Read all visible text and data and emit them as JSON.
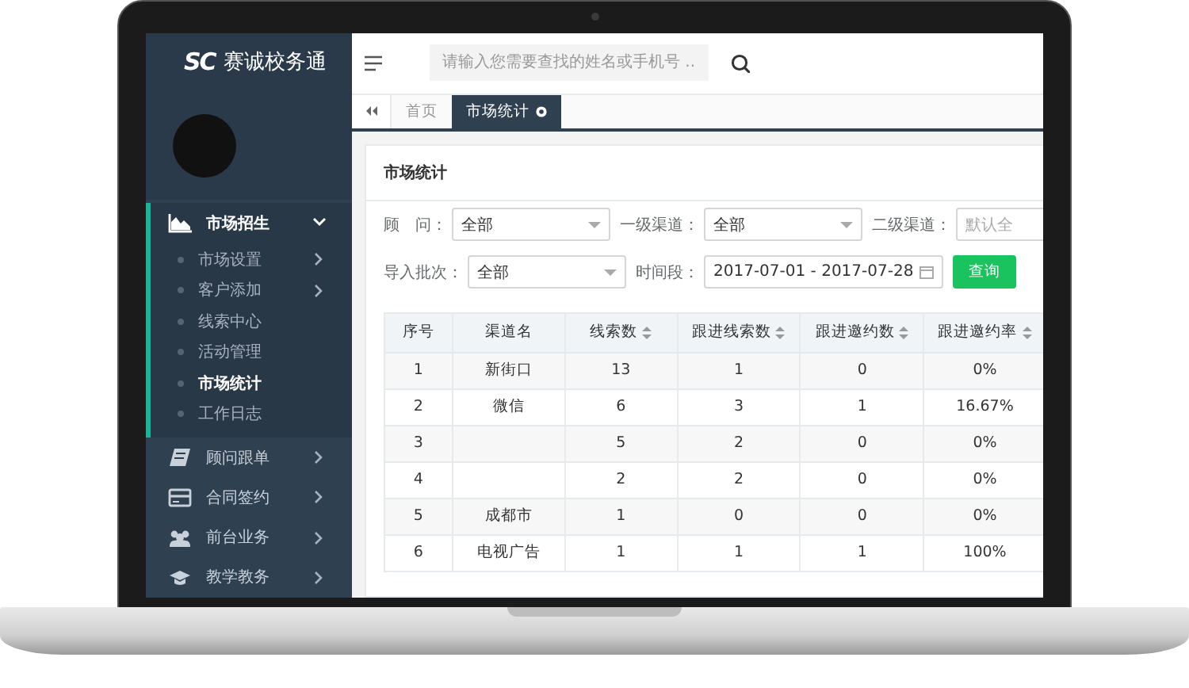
{
  "app": {
    "logo_text": "赛诚校务通",
    "logo_mark": "SC"
  },
  "header": {
    "search_placeholder": "请输入您需要查找的姓名或手机号 ..."
  },
  "tabs": [
    {
      "label": "首页",
      "selected": false,
      "closable": false
    },
    {
      "label": "市场统计",
      "selected": true,
      "closable": true
    }
  ],
  "sidebar": {
    "items": [
      {
        "label": "市场招生",
        "kind": "chart",
        "expanded": true,
        "children": [
          {
            "label": "市场设置",
            "has_children": true,
            "selected": false
          },
          {
            "label": "客户添加",
            "has_children": true,
            "selected": false
          },
          {
            "label": "线索中心",
            "has_children": false,
            "selected": false
          },
          {
            "label": "活动管理",
            "has_children": false,
            "selected": false
          },
          {
            "label": "市场统计",
            "has_children": false,
            "selected": true
          },
          {
            "label": "工作日志",
            "has_children": false,
            "selected": false
          }
        ]
      },
      {
        "label": "顾问跟单",
        "kind": "book",
        "expanded": false
      },
      {
        "label": "合同签约",
        "kind": "card",
        "expanded": false
      },
      {
        "label": "前台业务",
        "kind": "people",
        "expanded": false
      },
      {
        "label": "教学教务",
        "kind": "cap",
        "expanded": false
      }
    ]
  },
  "page": {
    "title": "市场统计",
    "filter_rows": [
      [
        {
          "label": "顾　问：",
          "kind": "select",
          "value": "全部"
        },
        {
          "label": "一级渠道：",
          "kind": "select",
          "value": "全部"
        },
        {
          "label": "二级渠道：",
          "kind": "text",
          "placeholder": "默认全"
        }
      ],
      [
        {
          "label": "导入批次：",
          "kind": "select",
          "value": "全部"
        },
        {
          "label": "时间段：",
          "kind": "daterange",
          "value": "2017-07-01 - 2017-07-28"
        }
      ]
    ],
    "query_button": "查询"
  },
  "table": {
    "columns": [
      {
        "label": "序号",
        "sortable": false
      },
      {
        "label": "渠道名",
        "sortable": false
      },
      {
        "label": "线索数",
        "sortable": true
      },
      {
        "label": "跟进线索数",
        "sortable": true
      },
      {
        "label": "跟进邀约数",
        "sortable": true
      },
      {
        "label": "跟进邀约率",
        "sortable": true
      }
    ],
    "rows": [
      [
        "1",
        "新街口",
        "13",
        "1",
        "0",
        "0%"
      ],
      [
        "2",
        "微信",
        "6",
        "3",
        "1",
        "16.67%"
      ],
      [
        "3",
        "",
        "5",
        "2",
        "0",
        "0%"
      ],
      [
        "4",
        "",
        "2",
        "2",
        "0",
        "0%"
      ],
      [
        "5",
        "成都市",
        "1",
        "0",
        "0",
        "0%"
      ],
      [
        "6",
        "电视广告",
        "1",
        "1",
        "1",
        "100%"
      ]
    ]
  }
}
